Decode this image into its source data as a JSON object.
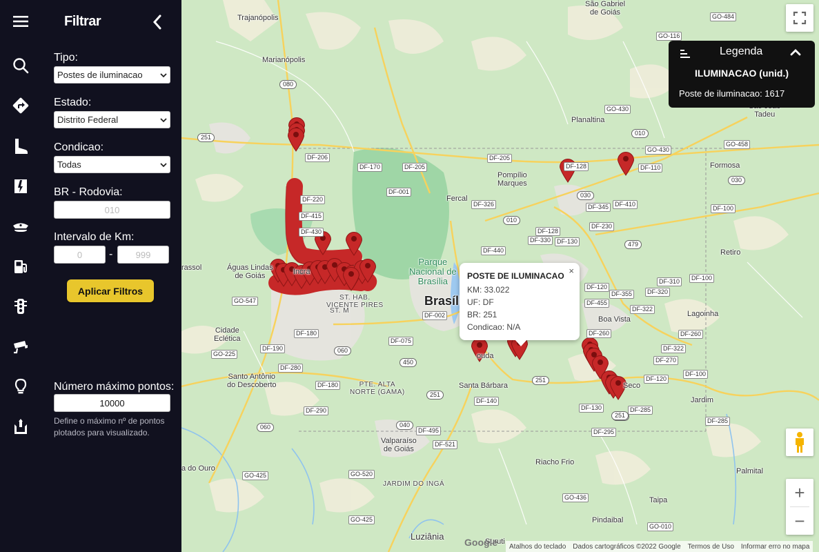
{
  "panel": {
    "title": "Filtrar",
    "tipo_label": "Tipo:",
    "tipo_value": "Postes de iluminacao",
    "estado_label": "Estado:",
    "estado_value": "Distrito Federal",
    "condicao_label": "Condicao:",
    "condicao_value": "Todas",
    "br_label": "BR - Rodovia:",
    "br_placeholder": "010",
    "km_label": "Intervalo de Km:",
    "km_from_placeholder": "0",
    "km_to_placeholder": "999",
    "km_dash": "-",
    "apply_label": "Aplicar Filtros",
    "maxpts_label": "Número máximo pontos:",
    "maxpts_value": "10000",
    "maxpts_help": "Define o máximo nº de pontos plotados para visualizado."
  },
  "rail": {
    "icons": [
      "menu-icon",
      "search-icon",
      "route-icon",
      "boot-icon",
      "road-icon",
      "police-cap-icon",
      "fuel-icon",
      "traffic-light-icon",
      "camera-icon",
      "lightbulb-icon",
      "toll-icon"
    ]
  },
  "popup": {
    "title": "POSTE DE ILUMINACAO",
    "km": "KM: 33.022",
    "uf": "UF: DF",
    "br": "BR: 251",
    "condicao": "Condicao: N/A",
    "close": "×"
  },
  "legend": {
    "title": "Legenda",
    "subtitle": "ILUMINACAO (unid.)",
    "entry": "Poste de iluminacao: 1617"
  },
  "map": {
    "marker_color": "#c62828",
    "places": [
      {
        "id": "sao-gabriel",
        "text": "São Gabriel\nde Goiás"
      },
      {
        "id": "trajanopolis",
        "text": "Trajanópolis"
      },
      {
        "id": "marianopolis",
        "text": "Marianópolis"
      },
      {
        "id": "planaltina",
        "text": "Planaltina"
      },
      {
        "id": "sao-joao-tadeu",
        "text": "São João\nTadeu"
      },
      {
        "id": "formosa",
        "text": "Formosa"
      },
      {
        "id": "pompilio",
        "text": "Pompílio\nMarques"
      },
      {
        "id": "fercal",
        "text": "Fercal"
      },
      {
        "id": "retiro",
        "text": "Retiro"
      },
      {
        "id": "aguas-lindas",
        "text": "Águas Lindas\nde Goiás"
      },
      {
        "id": "brasilia",
        "text": "Brasília"
      },
      {
        "id": "parque",
        "text": "Parque\nNacional de\nBrasília"
      },
      {
        "id": "boa-vista",
        "text": "Boa Vista"
      },
      {
        "id": "lagoinha",
        "text": "Lagoinha"
      },
      {
        "id": "cidade-ecletica",
        "text": "Cidade\nEclética"
      },
      {
        "id": "santo-antonio",
        "text": "Santo Antônio\ndo Descoberto"
      },
      {
        "id": "santa-barbara",
        "text": "Santa Bárbara"
      },
      {
        "id": "jardim",
        "text": "Jardim"
      },
      {
        "id": "valparaiso",
        "text": "Valparaíso\nde Goiás"
      },
      {
        "id": "riacho-frio",
        "text": "Riacho Frio"
      },
      {
        "id": "palmital",
        "text": "Palmital"
      },
      {
        "id": "taipa",
        "text": "Taipa"
      },
      {
        "id": "pindaibal",
        "text": "Pindaibal"
      },
      {
        "id": "luziania",
        "text": "Luziânia"
      },
      {
        "id": "ouro",
        "text": "a do Ouro"
      },
      {
        "id": "rassol",
        "text": "rassol"
      },
      {
        "id": "suruti",
        "text": "Suruti"
      },
      {
        "id": "ceco",
        "text": "Seco"
      },
      {
        "id": "ouda",
        "text": "ouda"
      },
      {
        "id": "incra",
        "text": "Incra"
      }
    ],
    "districts": [
      {
        "id": "st-hab",
        "text": "ST. HAB.\nVICENTE PIRES"
      },
      {
        "id": "st-m",
        "text": "ST. M"
      },
      {
        "id": "pte-alta",
        "text": "PTE. ALTA\nNORTE (GAMA)"
      },
      {
        "id": "jardim-inga",
        "text": "JARDIM DO INGÁ"
      }
    ],
    "shields": [
      "GO-484",
      "GO-116",
      "080",
      "251",
      "GO-430",
      "010",
      "DF-206",
      "DF-170",
      "DF-205",
      "DF-128",
      "DF-205",
      "DF-110",
      "GO-458",
      "DF-001",
      "DF-220",
      "DF-415",
      "DF-430",
      "DF-326",
      "010",
      "030",
      "DF-345",
      "DF-410",
      "DF-100",
      "DF-128",
      "DF-330",
      "DF-130",
      "DF-230",
      "479",
      "DF-440",
      "GO-547",
      "DF-310",
      "DF-100",
      "DF-320",
      "DF-120",
      "DF-355",
      "DF-455",
      "DF-322",
      "DF-180",
      "DF-002",
      "DF-075",
      "060",
      "DF-260",
      "DF-260",
      "GO-225",
      "DF-190",
      "DF-280",
      "450",
      "DF-180",
      "DF-322",
      "DF-270",
      "DF-120",
      "DF-100",
      "251",
      "DF-140",
      "DF-130",
      "DF-285",
      "DF-285",
      "251",
      "DF-290",
      "DF-295",
      "060",
      "040",
      "DF-495",
      "DF-521",
      "GO-425",
      "GO-520",
      "GO-436",
      "GO-425",
      "GO-010",
      "030",
      "GO-430",
      "251",
      "251"
    ],
    "attribution": {
      "shortcuts": "Atalhos do teclado",
      "data": "Dados cartográficos ©2022 Google",
      "terms": "Termos de Uso",
      "report": "Informar erro no mapa"
    },
    "google": "Google",
    "zoom_in": "+",
    "zoom_out": "−"
  }
}
